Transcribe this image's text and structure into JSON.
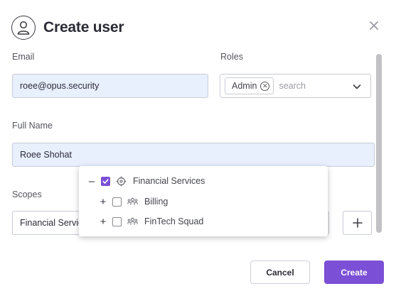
{
  "dialog": {
    "title": "Create user",
    "icons": {
      "header": "user-icon",
      "close": "close-icon"
    }
  },
  "form": {
    "email": {
      "label": "Email",
      "value": "roee@opus.security"
    },
    "roles": {
      "label": "Roles",
      "selected": [
        {
          "label": "Admin",
          "remove_icon": "remove-circle-x-icon"
        }
      ],
      "search_placeholder": "search"
    },
    "full_name": {
      "label": "Full Name",
      "value": "Roee Shohat"
    },
    "scopes": {
      "label": "Scopes",
      "value": "Financial Servic"
    }
  },
  "scope_tree": {
    "items": [
      {
        "toggle": "–",
        "checked": true,
        "icon": "crosshair-icon",
        "label": "Financial Services"
      },
      {
        "toggle": "+",
        "checked": false,
        "icon": "team-icon",
        "label": "Billing"
      },
      {
        "toggle": "+",
        "checked": false,
        "icon": "team-icon",
        "label": "FinTech Squad"
      }
    ]
  },
  "actions": {
    "cancel_label": "Cancel",
    "create_label": "Create"
  },
  "colors": {
    "accent": "#7b4fd6",
    "input_filled_bg": "#e8effd",
    "border": "#c9ccd6"
  }
}
